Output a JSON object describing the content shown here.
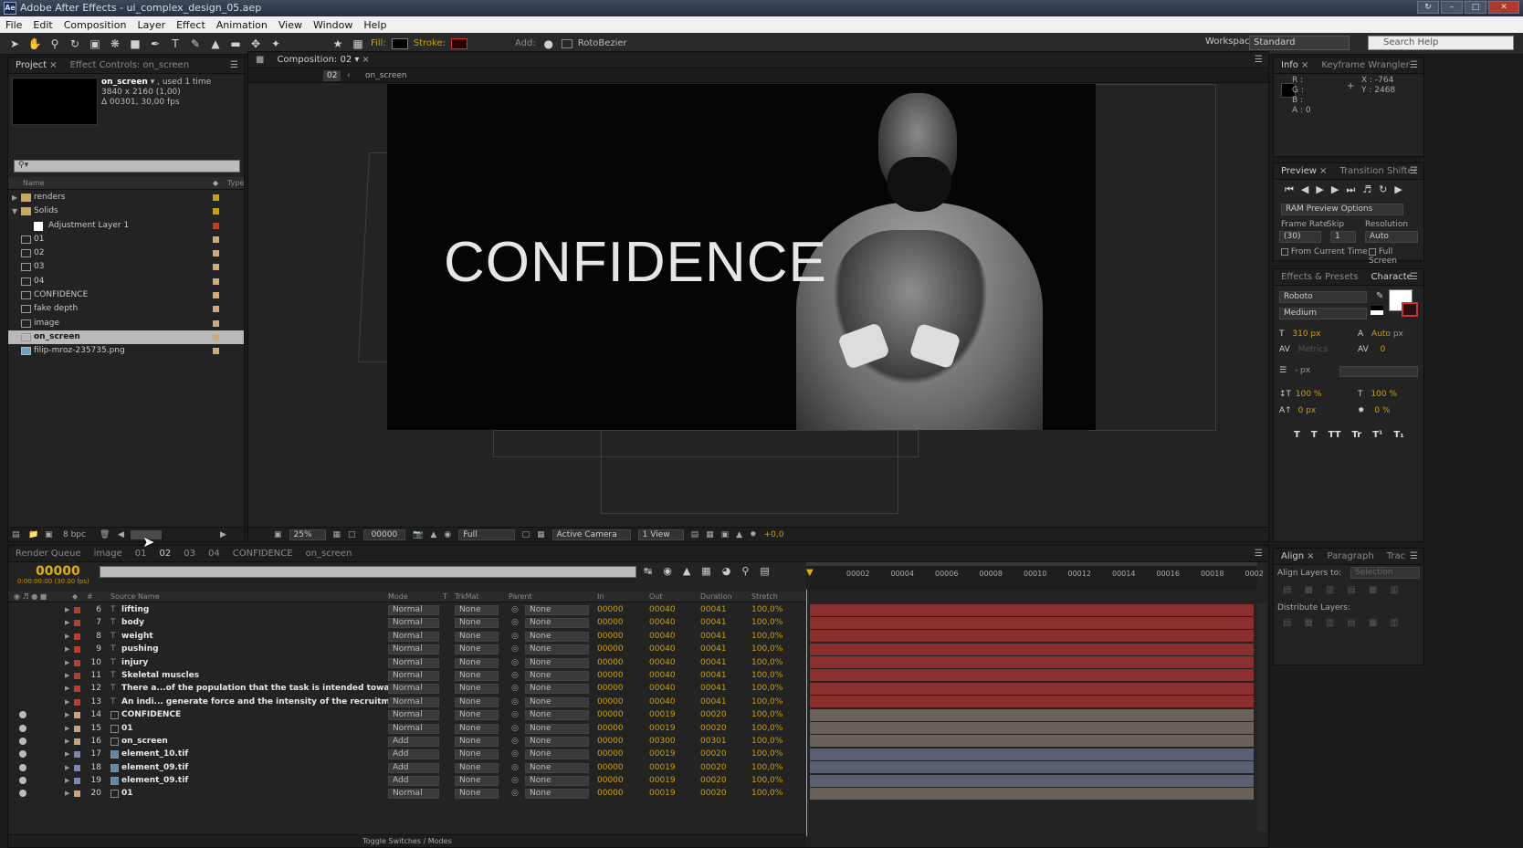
{
  "window": {
    "title": "Adobe After Effects - ui_complex_design_05.aep",
    "app_icon": "Ae"
  },
  "menu": [
    "File",
    "Edit",
    "Composition",
    "Layer",
    "Effect",
    "Animation",
    "View",
    "Window",
    "Help"
  ],
  "toolbar": {
    "fill_label": "Fill:",
    "stroke_label": "Stroke:",
    "add_label": "Add:",
    "roto_label": "RotoBezier",
    "workspace_label": "Workspace:",
    "workspace_value": "Standard",
    "search_placeholder": "Search Help"
  },
  "project": {
    "tabs": [
      "Project",
      "Effect Controls: on_screen"
    ],
    "selected_name": "on_screen",
    "selected_used": ", used 1 time",
    "selected_size": "3840 x 2160 (1,00)",
    "selected_duration": "Δ 00301, 30,00 fps",
    "col_name": "Name",
    "col_type": "Type",
    "items": [
      {
        "name": "renders",
        "kind": "folder",
        "label": "#c8a200",
        "twirl": "▶"
      },
      {
        "name": "Solids",
        "kind": "folder",
        "label": "#c8a200",
        "twirl": "▼"
      },
      {
        "name": "Adjustment Layer 1",
        "kind": "solid",
        "label": "#c0392b",
        "twirl": ""
      },
      {
        "name": "01",
        "kind": "comp",
        "label": "#d4a870",
        "twirl": ""
      },
      {
        "name": "02",
        "kind": "comp",
        "label": "#d4a870",
        "twirl": ""
      },
      {
        "name": "03",
        "kind": "comp",
        "label": "#d4a870",
        "twirl": ""
      },
      {
        "name": "04",
        "kind": "comp",
        "label": "#d4a870",
        "twirl": ""
      },
      {
        "name": "CONFIDENCE",
        "kind": "comp",
        "label": "#d4a870",
        "twirl": ""
      },
      {
        "name": "fake depth",
        "kind": "comp",
        "label": "#d4a870",
        "twirl": ""
      },
      {
        "name": "image",
        "kind": "comp",
        "label": "#d4a870",
        "twirl": ""
      },
      {
        "name": "on_screen",
        "kind": "comp",
        "label": "#d4a870",
        "twirl": "",
        "selected": true
      },
      {
        "name": "filip-mroz-235735.png",
        "kind": "img",
        "label": "#d4a870",
        "twirl": ""
      }
    ],
    "bpc": "8 bpc"
  },
  "composition": {
    "tab": "Composition: 02",
    "breadcrumb_comp": "02",
    "breadcrumb_next": "on_screen",
    "viewer_text": "CONFIDENCE",
    "zoom": "25%",
    "timecode": "00000",
    "resolution": "Full",
    "camera": "Active Camera",
    "views": "1 View",
    "exposure": "+0,0"
  },
  "info": {
    "tabs": [
      "Info",
      "Keyframe Wrangler"
    ],
    "r": "R :",
    "g": "G :",
    "b": "B :",
    "a": "A : 0",
    "x": "X : -764",
    "y": "Y : 2468"
  },
  "preview": {
    "tabs": [
      "Preview",
      "Transition Shifter"
    ],
    "ram_options": "RAM Preview Options",
    "frame_rate_label": "Frame Rate",
    "skip_label": "Skip",
    "resolution_label": "Resolution",
    "frame_rate": "(30)",
    "skip": "1",
    "resolution": "Auto",
    "from_current": "From Current Time",
    "full_screen": "Full Screen"
  },
  "character": {
    "tabs": [
      "Effects & Presets",
      "Characte"
    ],
    "font": "Roboto",
    "style": "Medium",
    "size": "310 px",
    "leading": "Auto",
    "leading_unit": "px",
    "kerning": "Metrics",
    "tracking": "0",
    "stroke_unit": "- px",
    "v_scale": "100 %",
    "h_scale": "100 %",
    "baseline": "0 px",
    "tsume": "0 %",
    "styles": [
      "T",
      "T",
      "TT",
      "Tr",
      "T¹",
      "T₁"
    ]
  },
  "align": {
    "tabs": [
      "Align",
      "Paragraph",
      "Trac"
    ],
    "layers_to": "Align Layers to:",
    "selection": "Selection",
    "distribute": "Distribute Layers:"
  },
  "timeline": {
    "tabs": [
      "Render Queue",
      "image",
      "01",
      "02",
      "03",
      "04",
      "CONFIDENCE",
      "on_screen"
    ],
    "active_tab": "02",
    "current_time": "00000",
    "current_time_sub": "0:00:00:00 (30.00 fps)",
    "columns": {
      "num": "#",
      "source": "Source Name",
      "mode": "Mode",
      "t": "T",
      "trkmat": "TrkMat",
      "parent": "Parent",
      "in": "In",
      "out": "Out",
      "duration": "Duration",
      "stretch": "Stretch"
    },
    "ruler": [
      "00002",
      "00004",
      "00006",
      "00008",
      "00010",
      "00012",
      "00014",
      "00016",
      "00018",
      "0002"
    ],
    "toggle_label": "Toggle Switches / Modes",
    "layers": [
      {
        "n": "6",
        "name": "lifting",
        "type": "T",
        "mode": "Normal",
        "trk": "None",
        "parent": "None",
        "in": "00000",
        "out": "00040",
        "dur": "00041",
        "st": "100,0%",
        "label": "#c0392b",
        "eye": false,
        "bar": "#8a2e2e"
      },
      {
        "n": "7",
        "name": "body",
        "type": "T",
        "mode": "Normal",
        "trk": "None",
        "parent": "None",
        "in": "00000",
        "out": "00040",
        "dur": "00041",
        "st": "100,0%",
        "label": "#c0392b",
        "eye": false,
        "bar": "#8a2e2e"
      },
      {
        "n": "8",
        "name": "weight",
        "type": "T",
        "mode": "Normal",
        "trk": "None",
        "parent": "None",
        "in": "00000",
        "out": "00040",
        "dur": "00041",
        "st": "100,0%",
        "label": "#c0392b",
        "eye": false,
        "bar": "#8a2e2e"
      },
      {
        "n": "9",
        "name": "pushing",
        "type": "T",
        "mode": "Normal",
        "trk": "None",
        "parent": "None",
        "in": "00000",
        "out": "00040",
        "dur": "00041",
        "st": "100,0%",
        "label": "#c0392b",
        "eye": false,
        "bar": "#8a2e2e"
      },
      {
        "n": "10",
        "name": "injury",
        "type": "T",
        "mode": "Normal",
        "trk": "None",
        "parent": "None",
        "in": "00000",
        "out": "00040",
        "dur": "00041",
        "st": "100,0%",
        "label": "#c0392b",
        "eye": false,
        "bar": "#8a2e2e"
      },
      {
        "n": "11",
        "name": "Skeletal muscles",
        "type": "T",
        "mode": "Normal",
        "trk": "None",
        "parent": "None",
        "in": "00000",
        "out": "00040",
        "dur": "00041",
        "st": "100,0%",
        "label": "#c0392b",
        "eye": false,
        "bar": "#8a2e2e"
      },
      {
        "n": "12",
        "name": "There a...of the population that the task is intended towards.",
        "type": "T",
        "mode": "Normal",
        "trk": "None",
        "parent": "None",
        "in": "00000",
        "out": "00040",
        "dur": "00041",
        "st": "100,0%",
        "label": "#c0392b",
        "eye": false,
        "bar": "#8a2e2e"
      },
      {
        "n": "13",
        "name": "An indi... generate force and the intensity of the recruitment",
        "type": "T",
        "mode": "Normal",
        "trk": "None",
        "parent": "None",
        "in": "00000",
        "out": "00040",
        "dur": "00041",
        "st": "100,0%",
        "label": "#c0392b",
        "eye": false,
        "bar": "#8a2e2e"
      },
      {
        "n": "14",
        "name": "CONFIDENCE",
        "type": "C",
        "mode": "Normal",
        "trk": "None",
        "parent": "None",
        "in": "00000",
        "out": "00019",
        "dur": "00020",
        "st": "100,0%",
        "label": "#c9a27a",
        "eye": true,
        "bar": "#6a6258"
      },
      {
        "n": "15",
        "name": "01",
        "type": "C",
        "mode": "Normal",
        "trk": "None",
        "parent": "None",
        "in": "00000",
        "out": "00019",
        "dur": "00020",
        "st": "100,0%",
        "label": "#c9a27a",
        "eye": true,
        "bar": "#6a6258"
      },
      {
        "n": "16",
        "name": "on_screen",
        "type": "C",
        "mode": "Add",
        "trk": "None",
        "parent": "None",
        "in": "00000",
        "out": "00300",
        "dur": "00301",
        "st": "100,0%",
        "label": "#c9a27a",
        "eye": true,
        "bar": "#6a6258"
      },
      {
        "n": "17",
        "name": "element_10.tif",
        "type": "I",
        "mode": "Add",
        "trk": "None",
        "parent": "None",
        "in": "00000",
        "out": "00019",
        "dur": "00020",
        "st": "100,0%",
        "label": "#7a86b8",
        "eye": true,
        "bar": "#5a5f72"
      },
      {
        "n": "18",
        "name": "element_09.tif",
        "type": "I",
        "mode": "Add",
        "trk": "None",
        "parent": "None",
        "in": "00000",
        "out": "00019",
        "dur": "00020",
        "st": "100,0%",
        "label": "#7a86b8",
        "eye": true,
        "bar": "#5a5f72"
      },
      {
        "n": "19",
        "name": "element_09.tif",
        "type": "I",
        "mode": "Add",
        "trk": "None",
        "parent": "None",
        "in": "00000",
        "out": "00019",
        "dur": "00020",
        "st": "100,0%",
        "label": "#7a86b8",
        "eye": true,
        "bar": "#5a5f72"
      },
      {
        "n": "20",
        "name": "01",
        "type": "C",
        "mode": "Normal",
        "trk": "None",
        "parent": "None",
        "in": "00000",
        "out": "00019",
        "dur": "00020",
        "st": "100,0%",
        "label": "#c9a27a",
        "eye": true,
        "bar": "#6a6258"
      }
    ]
  }
}
